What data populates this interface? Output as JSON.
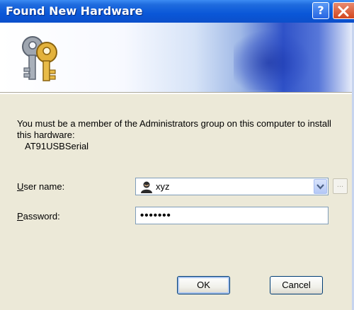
{
  "window": {
    "title": "Found New Hardware",
    "help_glyph": "?",
    "close_glyph": "×"
  },
  "banner": {
    "icon": "keys-icon"
  },
  "message": {
    "line1": "You must be a member of the Administrators group on this computer to install this hardware:",
    "device": "AT91USBSerial"
  },
  "form": {
    "username_label_accel": "U",
    "username_label_rest": "ser name:",
    "username_value": "xyz",
    "username_icon": "user-icon",
    "browse_label": "...",
    "password_label_accel": "P",
    "password_label_rest": "assword:",
    "password_value": "•••••••"
  },
  "buttons": {
    "ok": "OK",
    "cancel": "Cancel"
  },
  "colors": {
    "titlebar": "#0a57d8",
    "dialog_bg": "#ece9d8",
    "close": "#d2461e"
  }
}
